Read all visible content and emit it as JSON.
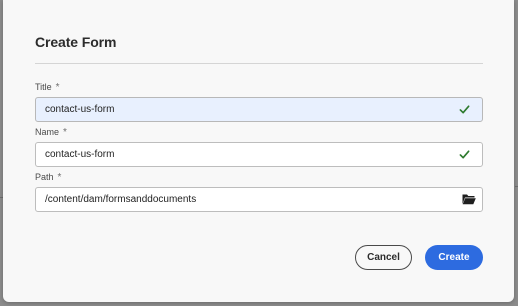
{
  "dialog": {
    "title": "Create Form",
    "required_marker": "*",
    "fields": {
      "title": {
        "label": "Title",
        "value": "contact-us-form",
        "placeholder": ""
      },
      "name": {
        "label": "Name",
        "value": "contact-us-form",
        "placeholder": ""
      },
      "path": {
        "label": "Path",
        "value": "/content/dam/formsanddocuments",
        "placeholder": ""
      }
    },
    "buttons": {
      "cancel_label": "Cancel",
      "create_label": "Create"
    }
  },
  "colors": {
    "accent": "#2d6be0",
    "valid_check": "#2d7a2d",
    "autofill_bg": "#e8f0fe"
  },
  "icons": [
    "checkmark-icon",
    "checkmark-icon",
    "folder-open-icon"
  ]
}
